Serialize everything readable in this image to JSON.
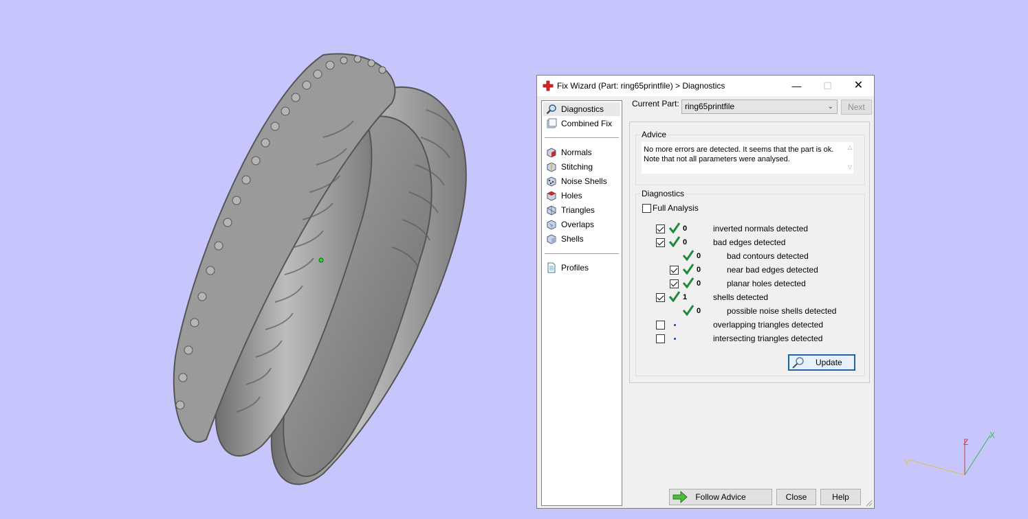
{
  "dialog": {
    "title": "Fix Wizard (Part: ring65printfile) > Diagnostics",
    "window_controls": {
      "minimize": "—",
      "maximize": "☐",
      "close": "✕"
    }
  },
  "nav": {
    "items": [
      {
        "label": "Diagnostics",
        "icon": "magnifier-icon",
        "selected": true
      },
      {
        "label": "Combined Fix",
        "icon": "combined-fix-icon"
      },
      {
        "label": "Normals",
        "icon": "normals-cube-icon"
      },
      {
        "label": "Stitching",
        "icon": "stitching-cube-icon"
      },
      {
        "label": "Noise Shells",
        "icon": "noise-shells-cube-icon"
      },
      {
        "label": "Holes",
        "icon": "holes-cube-icon"
      },
      {
        "label": "Triangles",
        "icon": "triangles-cube-icon"
      },
      {
        "label": "Overlaps",
        "icon": "overlaps-cube-icon"
      },
      {
        "label": "Shells",
        "icon": "shells-cube-icon"
      },
      {
        "label": "Profiles",
        "icon": "document-icon"
      }
    ]
  },
  "current_part": {
    "label": "Current Part:",
    "value": "ring65printfile",
    "next_label": "Next"
  },
  "advice": {
    "title": "Advice",
    "text": "No more errors are detected. It seems that the part is ok.\nNote that not all parameters were analysed."
  },
  "diagnostics": {
    "title": "Diagnostics",
    "full_analysis_label": "Full Analysis",
    "full_analysis_checked": false,
    "rows": [
      {
        "checkbox": true,
        "checked": true,
        "status": "ok",
        "count": "0",
        "label": "inverted normals detected",
        "indent": 0
      },
      {
        "checkbox": true,
        "checked": true,
        "status": "ok",
        "count": "0",
        "label": "bad edges detected",
        "indent": 0
      },
      {
        "checkbox": false,
        "checked": false,
        "status": "ok",
        "count": "0",
        "label": "bad contours detected",
        "indent": 1
      },
      {
        "checkbox": true,
        "checked": true,
        "status": "ok",
        "count": "0",
        "label": "near bad edges detected",
        "indent": 1
      },
      {
        "checkbox": true,
        "checked": true,
        "status": "ok",
        "count": "0",
        "label": "planar holes detected",
        "indent": 1
      },
      {
        "checkbox": true,
        "checked": true,
        "status": "ok",
        "count": "1",
        "label": "shells detected",
        "indent": 0
      },
      {
        "checkbox": false,
        "checked": false,
        "status": "ok",
        "count": "0",
        "label": "possible noise shells detected",
        "indent": 1
      },
      {
        "checkbox": true,
        "checked": false,
        "status": "pending",
        "count": "",
        "label": "overlapping triangles detected",
        "indent": 0
      },
      {
        "checkbox": true,
        "checked": false,
        "status": "pending",
        "count": "",
        "label": "intersecting triangles detected",
        "indent": 0
      }
    ],
    "update_label": "Update"
  },
  "buttons": {
    "follow_advice": "Follow Advice",
    "close": "Close",
    "help": "Help"
  },
  "axes": {
    "x": "X",
    "y": "Y",
    "z": "Z"
  },
  "colors": {
    "background": "#c7c6fc",
    "ok_check": "#1e8a3c",
    "accent_blue": "#1e5fae",
    "ring_grey": "#8a8a8a"
  }
}
